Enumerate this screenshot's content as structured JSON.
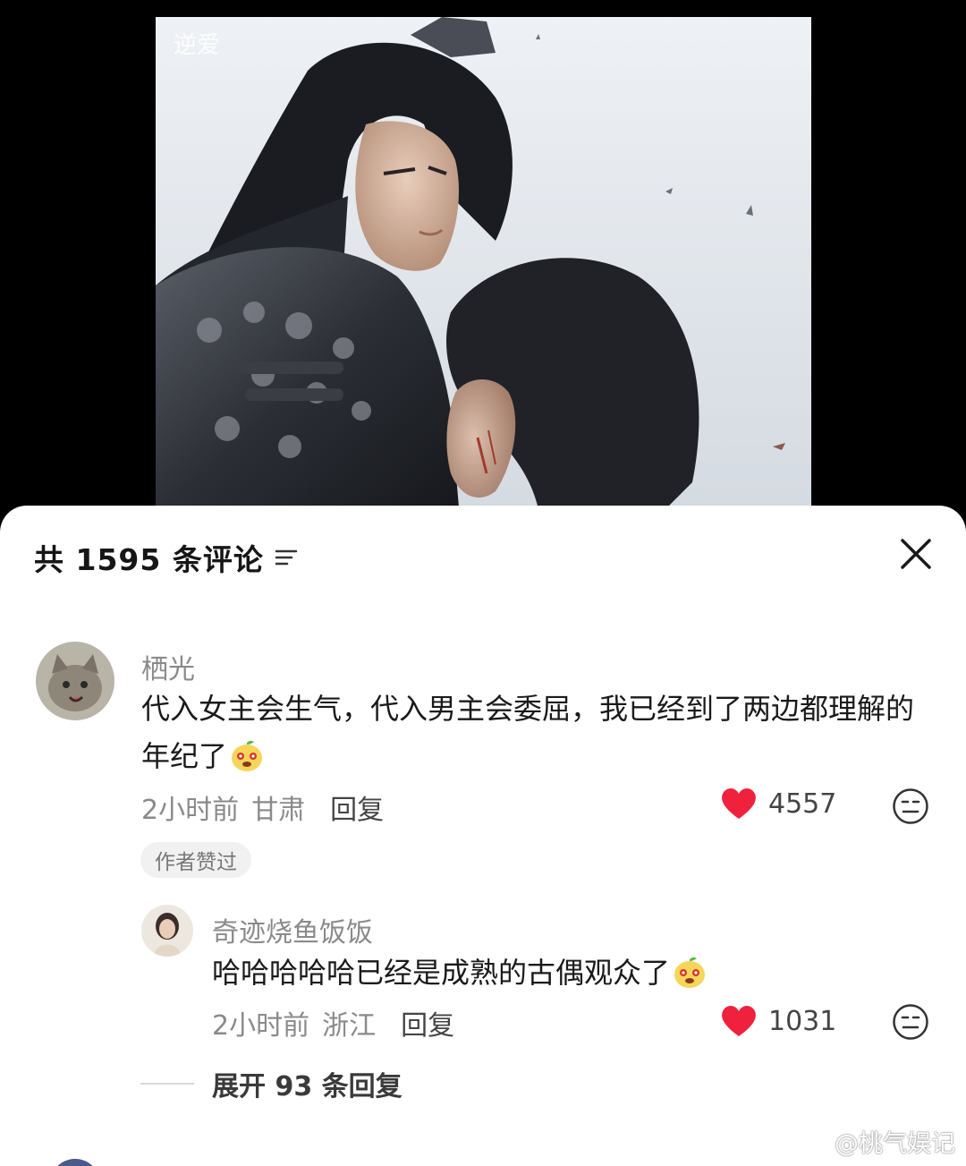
{
  "video": {
    "logo_text": "逆爱"
  },
  "sheet": {
    "title": "共 1595 条评论",
    "filter_icon": "filter-icon",
    "close_icon": "close-icon"
  },
  "comments": [
    {
      "username": "栖光",
      "text": "代入女主会生气，代入男主会委屈，我已经到了两边都理解的年纪了",
      "emoji": "mascot-emoji",
      "time": "2小时前",
      "location": "甘肃",
      "reply_label": "回复",
      "likes": "4557",
      "badge": "作者赞过",
      "replies": [
        {
          "username": "奇迹烧鱼饭饭",
          "text": "哈哈哈哈哈已经是成熟的古偶观众了",
          "emoji": "mascot-emoji",
          "time": "2小时前",
          "location": "浙江",
          "reply_label": "回复",
          "likes": "1031"
        }
      ],
      "expand_label": "展开 93 条回复"
    }
  ],
  "watermark": "@桃气娱记",
  "colors": {
    "like_red": "#f0213d",
    "sheet_bg": "#ffffff",
    "muted_text": "#8a8a8a"
  }
}
